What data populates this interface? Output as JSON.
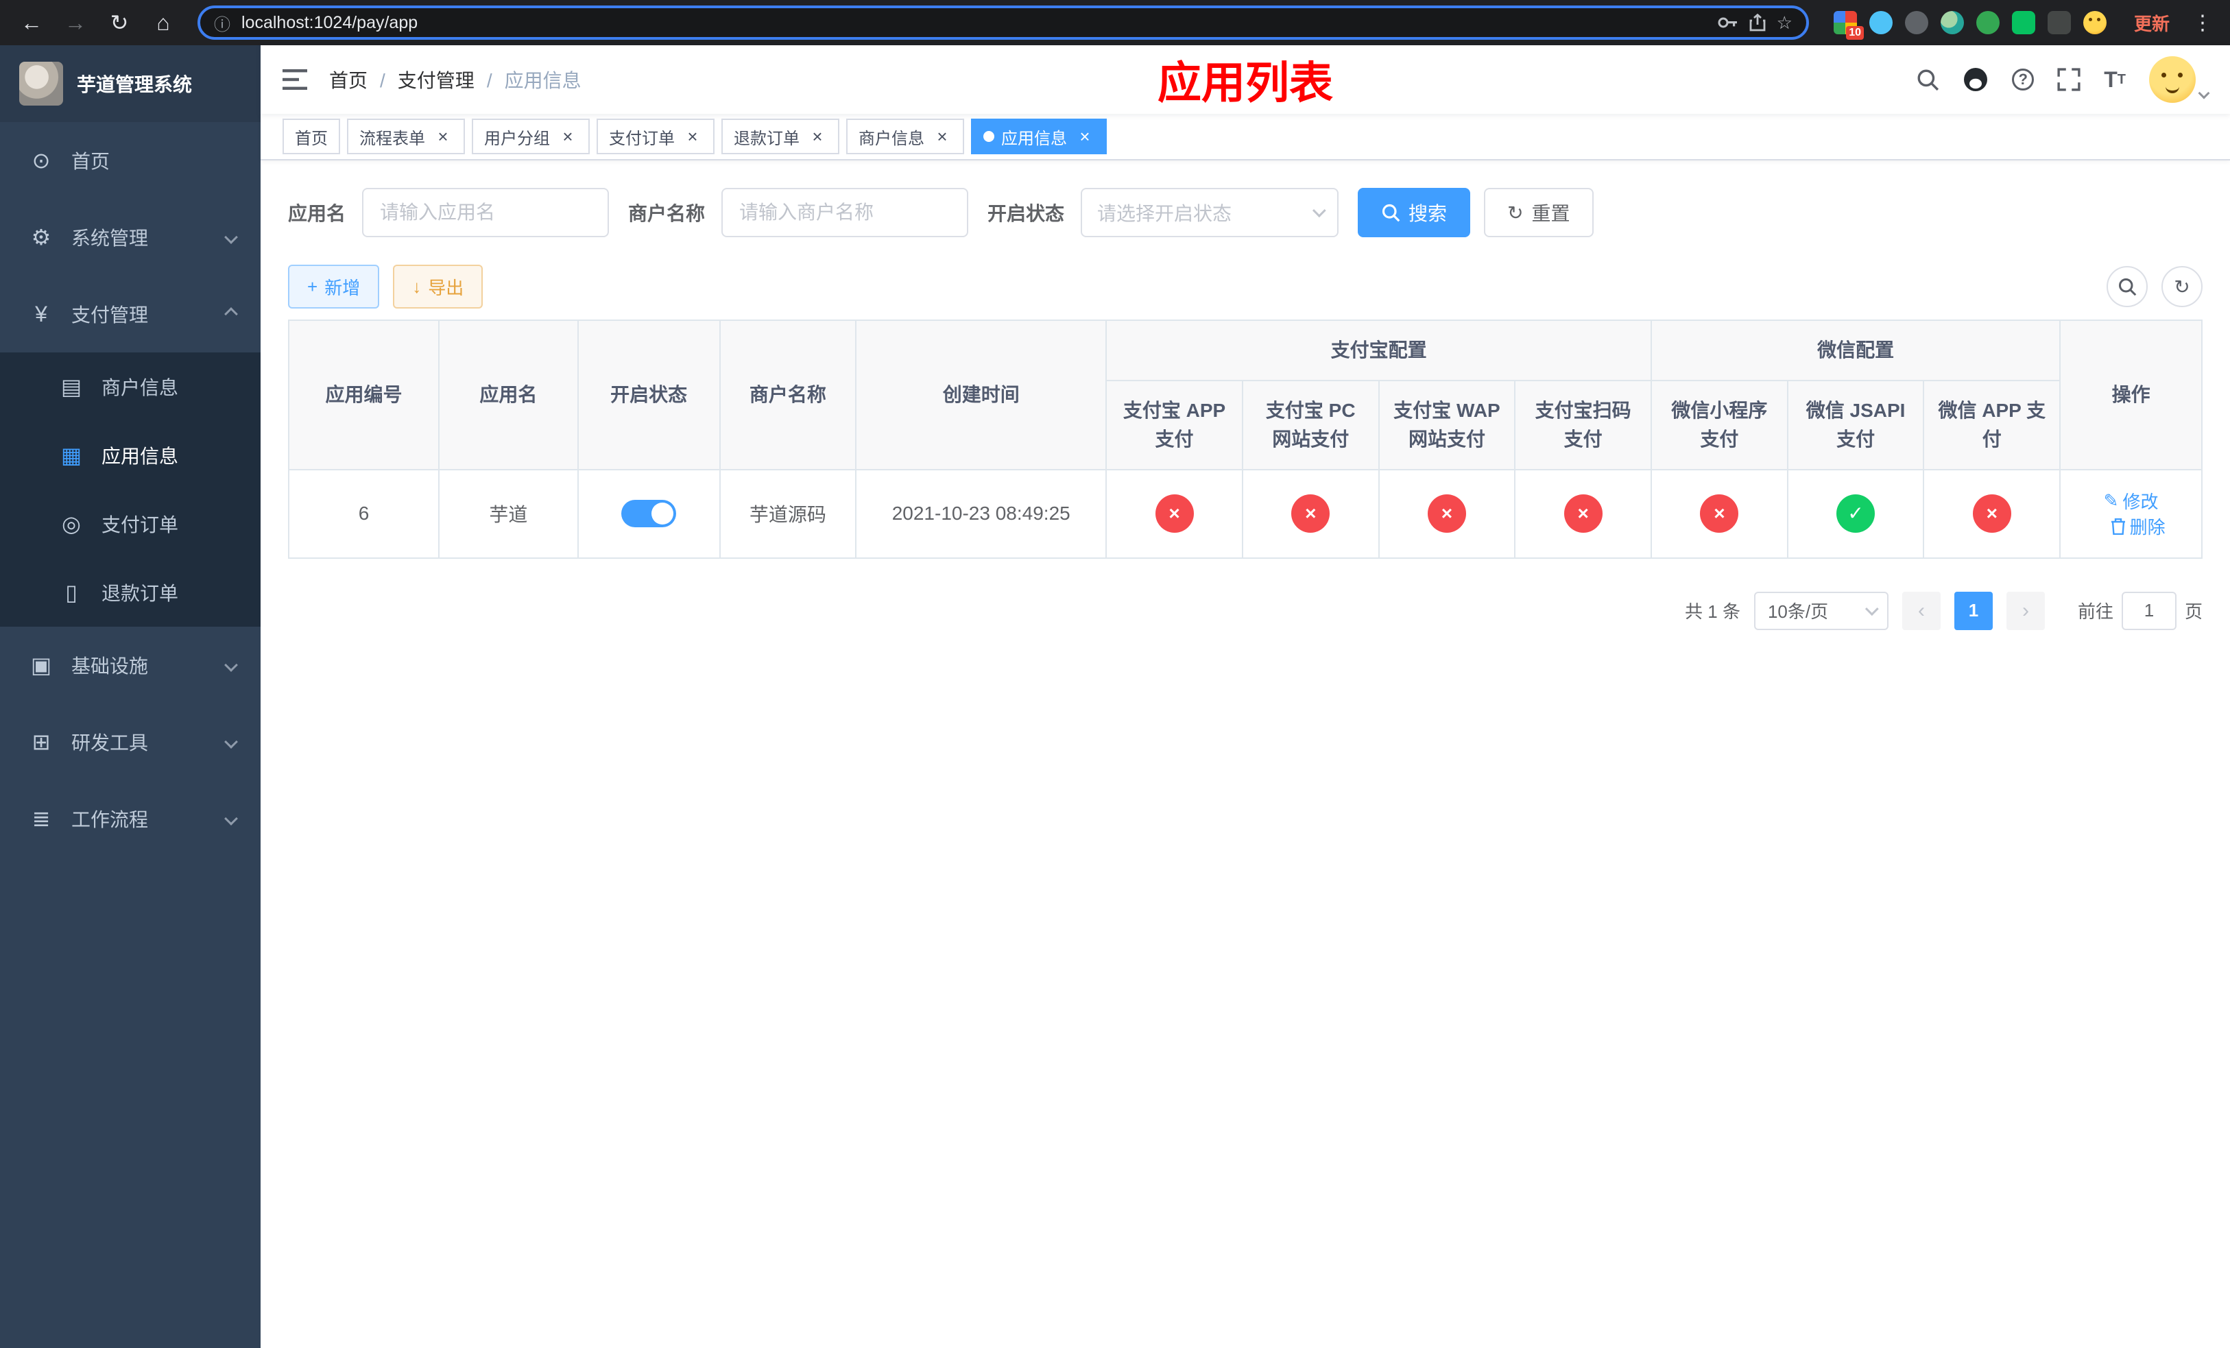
{
  "colors": {
    "accent": "#409eff",
    "danger_circle": "#f5494d",
    "success_circle": "#13ce66",
    "page_title": "#ff0000",
    "sidebar_bg": "#304156",
    "submenu_bg": "#1f2d3d"
  },
  "icons": {
    "back": "←",
    "forward": "→",
    "reload": "↻",
    "home": "⌂",
    "info": "ⓘ",
    "star": "☆",
    "more": "⋮",
    "close": "×",
    "check": "✓",
    "cross": "×",
    "plus": "+",
    "download": "↓",
    "dashboard": "⊙",
    "gear": "⚙",
    "yen": "¥",
    "merchant": "▤",
    "app": "▦",
    "order": "◎",
    "refund": "▯",
    "infra": "▣",
    "tools": "⊞",
    "workflow": "≣",
    "edit": "✎",
    "prev": "‹",
    "next": "›",
    "question": "?",
    "font": "T"
  },
  "browser": {
    "url": "localhost:1024/pay/app",
    "update_label": "更新",
    "extension_badge": "10"
  },
  "sidebar": {
    "app_title": "芋道管理系统",
    "menu": {
      "home": "首页",
      "system": "系统管理",
      "payment": "支付管理",
      "infrastructure": "基础设施",
      "devtools": "研发工具",
      "workflow": "工作流程"
    },
    "payment_children": {
      "merchant_info": "商户信息",
      "app_info": "应用信息",
      "pay_order": "支付订单",
      "refund_order": "退款订单"
    }
  },
  "navbar": {
    "breadcrumb": [
      "首页",
      "支付管理",
      "应用信息"
    ],
    "page_title": "应用列表"
  },
  "tags": [
    "首页",
    "流程表单",
    "用户分组",
    "支付订单",
    "退款订单",
    "商户信息",
    "应用信息"
  ],
  "filters": {
    "app_name_label": "应用名",
    "app_name_placeholder": "请输入应用名",
    "merchant_label": "商户名称",
    "merchant_placeholder": "请输入商户名称",
    "status_label": "开启状态",
    "status_placeholder": "请选择开启状态",
    "search_label": "搜索",
    "reset_label": "重置"
  },
  "toolbar": {
    "add_label": "新增",
    "export_label": "导出"
  },
  "table": {
    "headers": {
      "app_id": "应用编号",
      "app_name": "应用名",
      "status": "开启状态",
      "merchant": "商户名称",
      "created": "创建时间",
      "alipay_group": "支付宝配置",
      "wechat_group": "微信配置",
      "alipay_app": "支付宝 APP 支付",
      "alipay_pc": "支付宝 PC 网站支付",
      "alipay_wap": "支付宝 WAP 网站支付",
      "alipay_scan": "支付宝扫码支付",
      "wechat_mini": "微信小程序支付",
      "wechat_jsapi": "微信 JSAPI 支付",
      "wechat_app": "微信 APP 支付",
      "actions": "操作"
    },
    "row": {
      "app_id": "6",
      "app_name": "芋道",
      "status_enabled": true,
      "merchant": "芋道源码",
      "created": "2021-10-23 08:49:25",
      "alipay_app": "disabled",
      "alipay_pc": "disabled",
      "alipay_wap": "disabled",
      "alipay_scan": "disabled",
      "wechat_mini": "disabled",
      "wechat_jsapi": "enabled",
      "wechat_app": "disabled",
      "edit_label": "修改",
      "delete_label": "删除"
    }
  },
  "pagination": {
    "total": "共 1 条",
    "page_size": "10条/页",
    "page": "1",
    "goto_label": "前往",
    "goto_value": "1",
    "unit_label": "页"
  }
}
